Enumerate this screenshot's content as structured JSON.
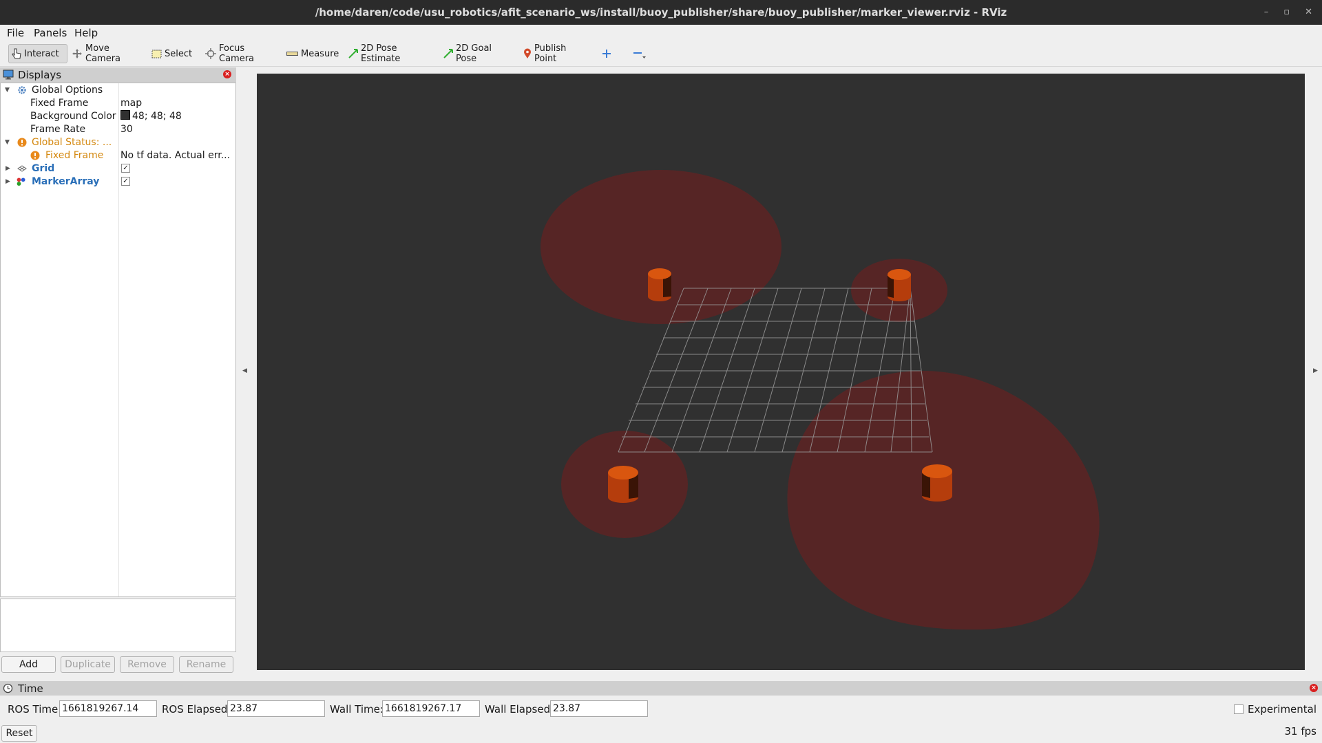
{
  "window": {
    "title": "/home/daren/code/usu_robotics/afit_scenario_ws/install/buoy_publisher/share/buoy_publisher/marker_viewer.rviz - RViz",
    "controls": [
      "–",
      "▫",
      "✕"
    ]
  },
  "menu": [
    "File",
    "Panels",
    "Help"
  ],
  "toolbar": {
    "interact": "Interact",
    "move_camera": "Move Camera",
    "select": "Select",
    "focus_camera": "Focus Camera",
    "measure": "Measure",
    "pose_estimate": "2D Pose Estimate",
    "goal_pose": "2D Goal Pose",
    "publish_point": "Publish Point"
  },
  "displays": {
    "title": "Displays",
    "global_options": {
      "label": "Global Options",
      "fixed_frame_label": "Fixed Frame",
      "fixed_frame_value": "map",
      "background_color_label": "Background Color",
      "background_color_value": "48; 48; 48",
      "frame_rate_label": "Frame Rate",
      "frame_rate_value": "30"
    },
    "global_status": {
      "label": "Global Status: ...",
      "fixed_frame_label": "Fixed Frame",
      "fixed_frame_value": "No tf data.  Actual err..."
    },
    "grid": {
      "label": "Grid",
      "enabled": true
    },
    "marker_array": {
      "label": "MarkerArray",
      "enabled": true
    },
    "buttons": {
      "add": "Add",
      "duplicate": "Duplicate",
      "remove": "Remove",
      "rename": "Rename"
    }
  },
  "viewport": {
    "background_color": "#303030",
    "grid_color": "#9a9a9a",
    "buoy_color": "#c8460f",
    "zone_color": "#5a2525"
  },
  "time": {
    "title": "Time",
    "ros_time_label": "ROS Time:",
    "ros_time": "1661819267.14",
    "ros_elapsed_label": "ROS Elapsed:",
    "ros_elapsed": "23.87",
    "wall_time_label": "Wall Time:",
    "wall_time": "1661819267.17",
    "wall_elapsed_label": "Wall Elapsed:",
    "wall_elapsed": "23.87",
    "experimental": "Experimental",
    "reset": "Reset",
    "fps": "31 fps"
  }
}
